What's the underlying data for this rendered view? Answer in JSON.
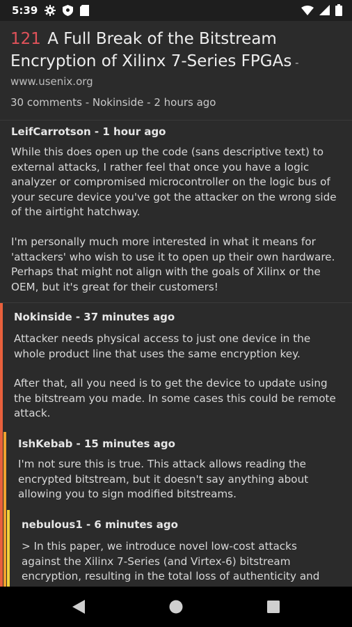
{
  "status_bar": {
    "time": "5:39",
    "left_icons": [
      "gear-icon",
      "shield-icon",
      "sd-card-icon"
    ],
    "right_icons": [
      "wifi-icon",
      "signal-icon",
      "battery-icon"
    ]
  },
  "story": {
    "score": "121",
    "title": "A Full Break of the Bitstream Encryption of Xilinx 7-Series FPGAs",
    "domain_separator": " - ",
    "domain": "www.usenix.org",
    "meta": "30 comments - Nokinside - 2 hours ago"
  },
  "comments": [
    {
      "author_line": "LeifCarrotson - 1 hour ago",
      "depth": 0,
      "color": "",
      "paragraphs": [
        "While this does open up the code (sans descriptive text) to external attacks, I rather feel that once you have a logic analyzer or compromised microcontroller on the logic bus of your secure device you've got the attacker on the wrong side of the airtight hatchway.",
        "I'm personally much more interested in what it means for 'attackers' who wish to use it to open up their own hardware. Perhaps that might not align with the goals of Xilinx or the OEM, but it's great for their customers!"
      ]
    },
    {
      "author_line": "Nokinside - 37 minutes ago",
      "depth": 1,
      "color": "#e8603c",
      "paragraphs": [
        "Attacker needs physical access to just one device in the whole product line that uses the same encryption key.",
        "After that, all you need is to get the device to update using the bitstream you made. In some cases this could be remote attack."
      ]
    },
    {
      "author_line": "IshKebab - 15 minutes ago",
      "depth": 2,
      "color": "#f0a22e",
      "paragraphs": [
        "I'm not sure this is true. This attack allows reading the encrypted bitstream, but it doesn't say anything about allowing you to sign modified bitstreams."
      ]
    },
    {
      "author_line": "nebulous1 - 6 minutes ago",
      "depth": 3,
      "color": "#f2d13a",
      "paragraphs": [
        "> In this paper, we introduce novel low-cost attacks against the Xilinx 7-Series (and Virtex-6) bitstream encryption, resulting in the total loss of authenticity and confidentiality"
      ]
    }
  ],
  "nav_bar": {
    "buttons": [
      "back-icon",
      "home-icon",
      "recents-icon"
    ]
  }
}
